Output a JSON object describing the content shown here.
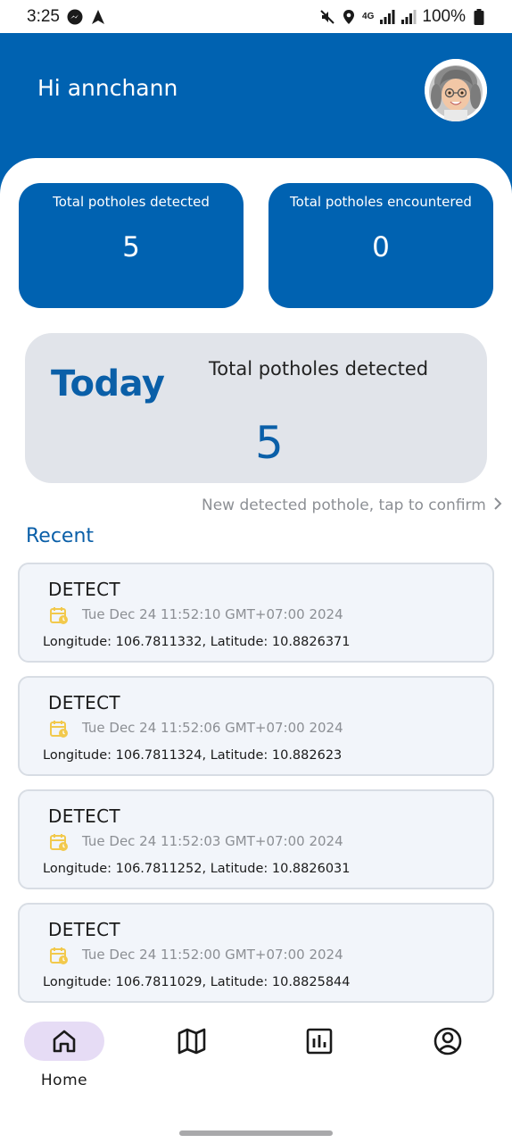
{
  "status_bar": {
    "time": "3:25",
    "battery": "100%",
    "network": "4G",
    "icons": [
      "messenger-icon",
      "navigation-icon",
      "mute-icon",
      "location-icon",
      "signal-icon",
      "battery-icon"
    ]
  },
  "header": {
    "greeting": "Hi annchann",
    "avatar_icon": "memoji-avatar",
    "background_color": "#0062b1"
  },
  "stats": {
    "detected_label": "Total potholes detected",
    "detected_value": "5",
    "encountered_label": "Total potholes encountered",
    "encountered_value": "0"
  },
  "today": {
    "title": "Today",
    "label": "Total potholes detected",
    "value": "5"
  },
  "confirm_link": "New detected pothole, tap to confirm",
  "recent": {
    "title": "Recent",
    "items": [
      {
        "type": "DETECT",
        "date": "Tue Dec 24 11:52:10 GMT+07:00 2024",
        "coords": "Longitude: 106.7811332, Latitude: 10.8826371"
      },
      {
        "type": "DETECT",
        "date": "Tue Dec 24 11:52:06 GMT+07:00 2024",
        "coords": "Longitude: 106.7811324, Latitude: 10.882623"
      },
      {
        "type": "DETECT",
        "date": "Tue Dec 24 11:52:03 GMT+07:00 2024",
        "coords": "Longitude: 106.7811252, Latitude: 10.8826031"
      },
      {
        "type": "DETECT",
        "date": "Tue Dec 24 11:52:00 GMT+07:00 2024",
        "coords": "Longitude: 106.7811029, Latitude: 10.8825844"
      }
    ]
  },
  "bottom_nav": {
    "home_label": "Home",
    "items": [
      "home-icon",
      "map-icon",
      "stats-icon",
      "profile-icon"
    ],
    "active_color": "#e6dcf5"
  },
  "colors": {
    "primary": "#0062b1",
    "accent_text": "#0a5fa8",
    "card_gray": "#e1e4ea",
    "calendar_icon": "#f2c94c"
  }
}
